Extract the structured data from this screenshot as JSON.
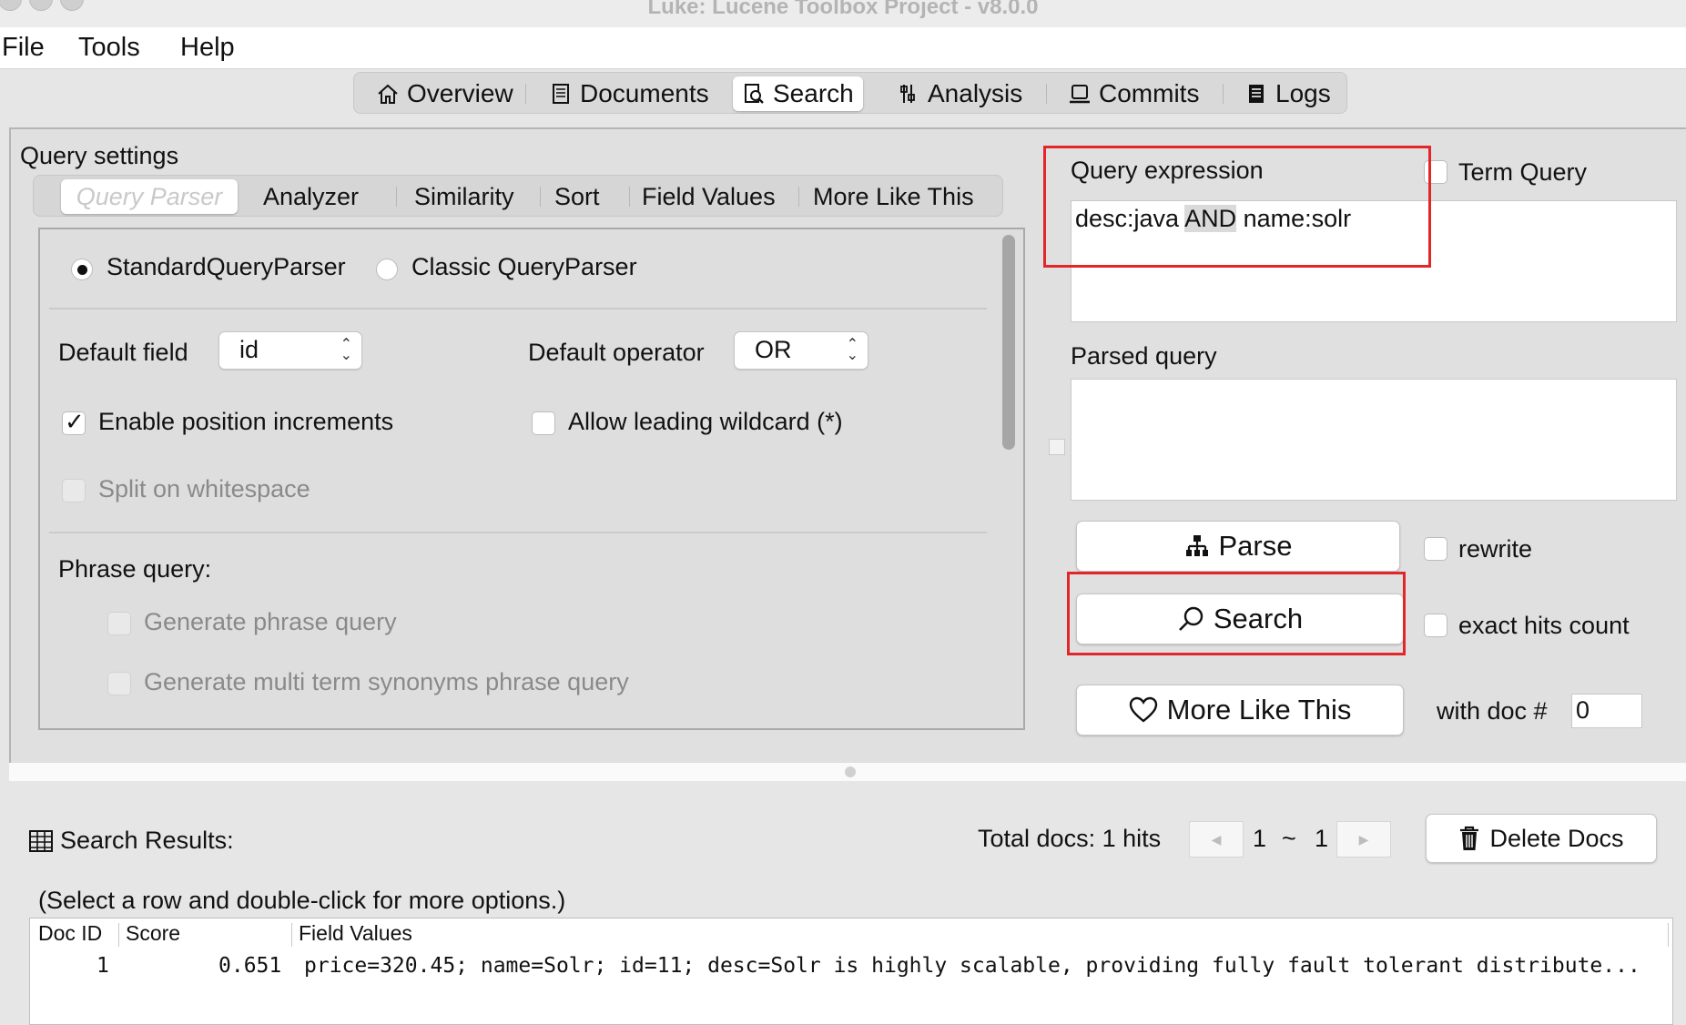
{
  "window": {
    "title": "Luke: Lucene Toolbox Project - v8.0.0"
  },
  "menu": [
    "File",
    "Tools",
    "Help"
  ],
  "main_tabs": [
    {
      "label": "Overview",
      "icon": "home-icon"
    },
    {
      "label": "Documents",
      "icon": "document-icon"
    },
    {
      "label": "Search",
      "icon": "search-doc-icon",
      "active": true
    },
    {
      "label": "Analysis",
      "icon": "tools-icon"
    },
    {
      "label": "Commits",
      "icon": "laptop-icon"
    },
    {
      "label": "Logs",
      "icon": "log-icon"
    }
  ],
  "query_settings": {
    "title": "Query settings",
    "sub_tabs": [
      "Query Parser",
      "Analyzer",
      "Similarity",
      "Sort",
      "Field Values",
      "More Like This"
    ],
    "parser": {
      "standard_label": "StandardQueryParser",
      "classic_label": "Classic QueryParser",
      "selected": "StandardQueryParser",
      "default_field_label": "Default field",
      "default_field_value": "id",
      "default_operator_label": "Default operator",
      "default_operator_value": "OR",
      "enable_position_increments": "Enable position increments",
      "allow_leading_wildcard": "Allow leading wildcard (*)",
      "split_on_whitespace": "Split on whitespace",
      "phrase_query_label": "Phrase query:",
      "generate_phrase_query": "Generate phrase query",
      "generate_multi_term": "Generate multi term synonyms phrase query"
    }
  },
  "query": {
    "expression_label": "Query expression",
    "expr_part1": "desc:java ",
    "expr_and": "AND",
    "expr_part2": " name:solr",
    "term_query_label": "Term Query",
    "parsed_label": "Parsed query",
    "parse_button": "Parse",
    "rewrite_label": "rewrite",
    "search_button": "Search",
    "exact_hits_label": "exact hits count",
    "mlt_button": "More Like This",
    "with_doc_label": "with doc #",
    "with_doc_value": "0"
  },
  "results": {
    "title": "Search Results:",
    "total_docs": "Total docs: 1 hits",
    "page_from": "1",
    "page_sep": "~",
    "page_to": "1",
    "delete_button": "Delete Docs",
    "hint": "(Select a row and double-click for more options.)",
    "columns": [
      "Doc ID",
      "Score",
      "Field Values"
    ],
    "rows": [
      {
        "doc_id": "1",
        "score": "0.651",
        "fields": "price=320.45; name=Solr; id=11; desc=Solr is highly scalable, providing fully fault tolerant distribute..."
      }
    ]
  },
  "colors": {
    "highlight_red": "#e3262a"
  }
}
